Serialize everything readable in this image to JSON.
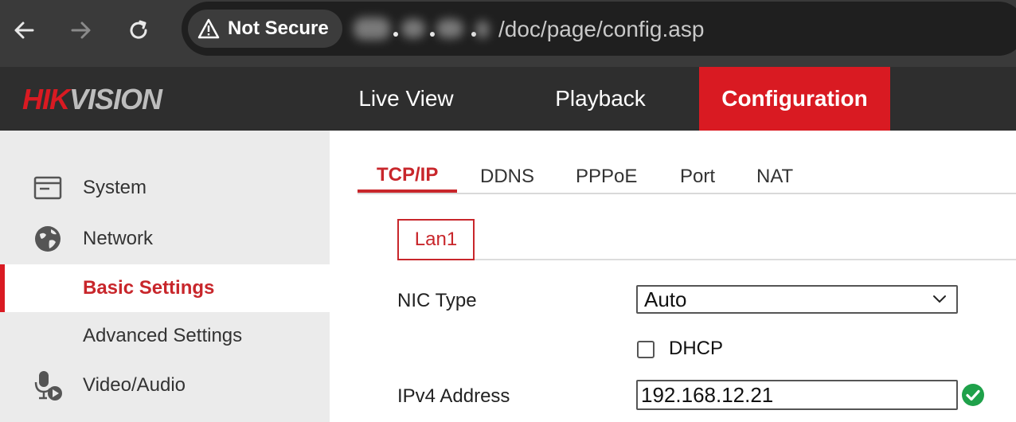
{
  "browser": {
    "security_label": "Not Secure",
    "url_path": "/doc/page/config.asp",
    "icons": {
      "back": "arrow-left-icon",
      "forward": "arrow-right-icon",
      "reload": "reload-icon",
      "warning": "warning-triangle-icon"
    }
  },
  "header": {
    "logo_text": "HIKVISION",
    "nav": [
      {
        "label": "Live View"
      },
      {
        "label": "Playback"
      },
      {
        "label": "Configuration",
        "active": true
      }
    ]
  },
  "sidebar": {
    "items": [
      {
        "label": "System",
        "icon": "monitor-icon"
      },
      {
        "label": "Network",
        "icon": "globe-icon"
      },
      {
        "label": "Basic Settings",
        "active": true
      },
      {
        "label": "Advanced Settings"
      },
      {
        "label": "Video/Audio",
        "icon": "microphone-camera-icon"
      }
    ]
  },
  "tabs": [
    {
      "label": "TCP/IP",
      "active": true
    },
    {
      "label": "DDNS"
    },
    {
      "label": "PPPoE"
    },
    {
      "label": "Port"
    },
    {
      "label": "NAT"
    }
  ],
  "subtab": {
    "label": "Lan1"
  },
  "form": {
    "nic_type": {
      "label": "NIC Type",
      "value": "Auto"
    },
    "dhcp": {
      "label": "DHCP",
      "checked": false
    },
    "ipv4": {
      "label": "IPv4 Address",
      "value": "192.168.12.21",
      "status": "valid"
    }
  },
  "colors": {
    "accent": "#d91a22",
    "header_bg": "#2e2e2e",
    "sidebar_bg": "#ebebeb",
    "valid": "#1fa14a"
  }
}
